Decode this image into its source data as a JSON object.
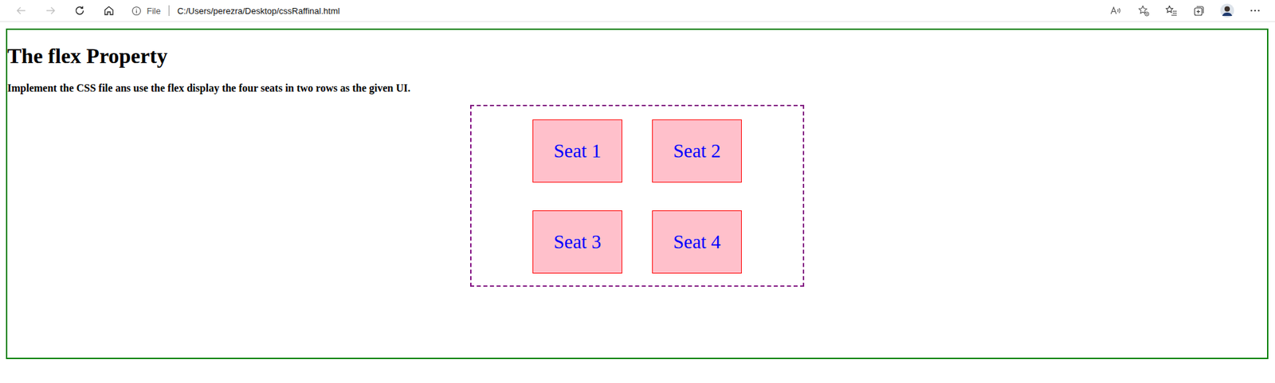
{
  "browser": {
    "back": {
      "disabled": true
    },
    "forward": {
      "disabled": true
    },
    "address": {
      "scheme_label": "File",
      "url": "C:/Users/perezra/Desktop/cssRaffinal.html"
    }
  },
  "page": {
    "heading": "The flex Property",
    "instruction": "Implement the CSS file ans use the flex display the four seats in two rows as the given UI.",
    "seats": [
      "Seat 1",
      "Seat 2",
      "Seat 3",
      "Seat 4"
    ]
  }
}
